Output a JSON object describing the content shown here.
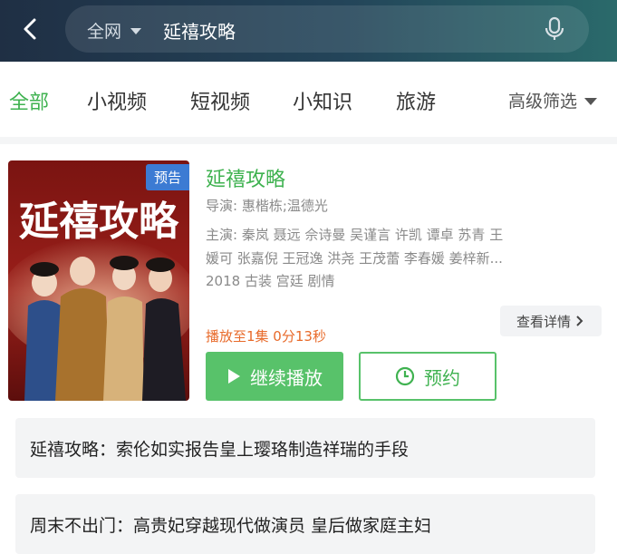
{
  "header": {
    "scope": "全网",
    "query": "延禧攻略"
  },
  "tabs": {
    "items": [
      "全部",
      "小视频",
      "短视频",
      "小知识",
      "旅游"
    ],
    "active_index": 0,
    "filter_label": "高级筛选"
  },
  "result": {
    "badge": "预告",
    "poster_title_art": "延禧攻略",
    "title": "延禧攻略",
    "director": "导演: 惠楷栋;温德光",
    "cast_line1": "主演: 秦岚  聂远  佘诗曼  吴谨言  许凯  谭卓  苏青  王",
    "cast_line2": "媛可  张嘉倪  王冠逸  洪尧  王茂蕾  李春媛  姜梓新...",
    "tags": "2018  古装 宫廷 剧情",
    "detail_label": "查看详情",
    "progress": "播放至1集 0分13秒",
    "play_label": "继续播放",
    "reserve_label": "预约"
  },
  "related": [
    "延禧攻略：索伦如实报告皇上璎珞制造祥瑞的手段",
    "周末不出门：高贵妃穿越现代做演员 皇后做家庭主妇"
  ],
  "colors": {
    "accent": "#3fb250",
    "play_bg": "#58c26a",
    "badge": "#3c7bd3",
    "progress": "#e86a2a"
  }
}
